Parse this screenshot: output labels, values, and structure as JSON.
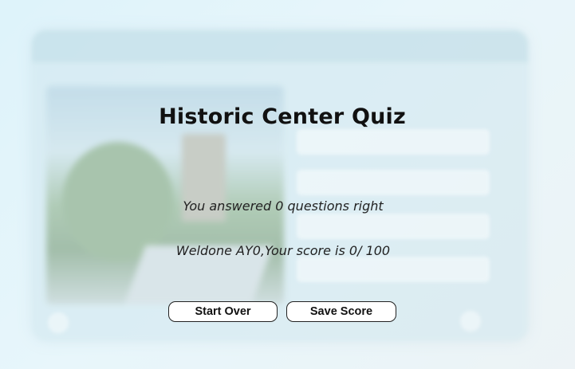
{
  "quiz": {
    "title": "Historic Center Quiz",
    "result_line": "You answered 0 questions right",
    "score_line": "Weldone AY0,Your score is 0/ 100"
  },
  "buttons": {
    "start_over": "Start Over",
    "save_score": "Save Score"
  },
  "colors": {
    "background": "#d7f1fb",
    "button_bg": "#ffffff",
    "button_border": "#222222",
    "text": "#111111"
  }
}
